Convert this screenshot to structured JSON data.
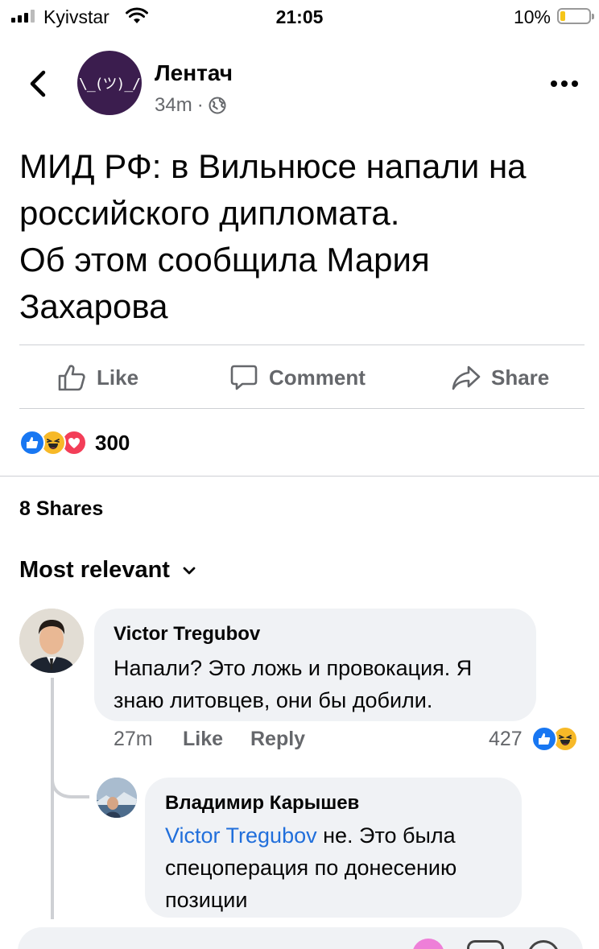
{
  "status_bar": {
    "carrier": "Kyivstar",
    "time": "21:05",
    "battery": "10%",
    "battery_level": 0.1
  },
  "post": {
    "page_name": "Лентач",
    "avatar_text": "\\_(ツ)_/",
    "time_ago": "34m",
    "separator": "·",
    "privacy_icon": "globe-icon",
    "text_lines": [
      "МИД РФ: в Вильнюсе напали на",
      "российского дипломата.",
      "Об этом сообщила Мария",
      "Захарова"
    ]
  },
  "actions": {
    "like": "Like",
    "comment": "Comment",
    "share": "Share"
  },
  "reactions": {
    "icons": [
      "like-reaction-icon",
      "haha-reaction-icon",
      "love-reaction-icon"
    ],
    "count": "300"
  },
  "shares": "8 Shares",
  "sort": {
    "label": "Most relevant"
  },
  "comments": [
    {
      "author": "Victor Tregubov",
      "text_lines": [
        "Напали? Это ложь и провокация. Я",
        "знаю литовцев, они бы добили."
      ],
      "time": "27m",
      "like": "Like",
      "reply": "Reply",
      "reaction_count": "427",
      "reaction_icons": [
        "like-reaction-icon",
        "haha-reaction-icon"
      ]
    }
  ],
  "replies": [
    {
      "author": "Владимир Карышев",
      "mention": "Victor Tregubov",
      "text_lines": [
        " не. Это была",
        "спецоперация по донесению",
        "позиции"
      ]
    }
  ],
  "colors": {
    "accent": "#216fdb",
    "like_blue": "#1877f2",
    "love_red": "#f33e58",
    "haha_yellow": "#f7b928",
    "secondary_text": "#65676b",
    "bubble_bg": "#f0f2f5"
  }
}
